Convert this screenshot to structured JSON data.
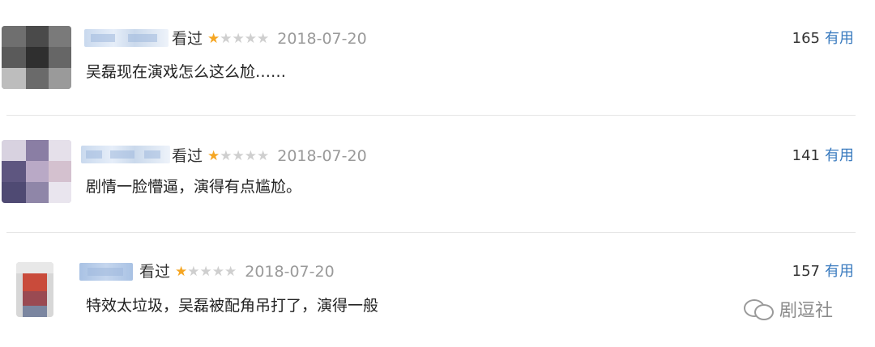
{
  "reviews": [
    {
      "count": "165",
      "useful": "有用",
      "status": "看过",
      "rating": 1,
      "date": "2018-07-20",
      "comment": "吴磊现在演戏怎么这么尬……"
    },
    {
      "count": "141",
      "useful": "有用",
      "status": "看过",
      "rating": 1,
      "date": "2018-07-20",
      "comment": "剧情一脸懵逼，演得有点尴尬。"
    },
    {
      "count": "157",
      "useful": "有用",
      "status": "看过",
      "rating": 1,
      "date": "2018-07-20",
      "comment": "特效太垃圾，吴磊被配角吊打了，演得一般"
    }
  ],
  "stars": {
    "on": "★",
    "off": "★★★★"
  },
  "watermark": {
    "text": "剧逗社",
    "icon": "wechat-icon"
  },
  "colors": {
    "star": "#f5a623",
    "link": "#3a7bbf",
    "date": "#9a9a9a"
  }
}
